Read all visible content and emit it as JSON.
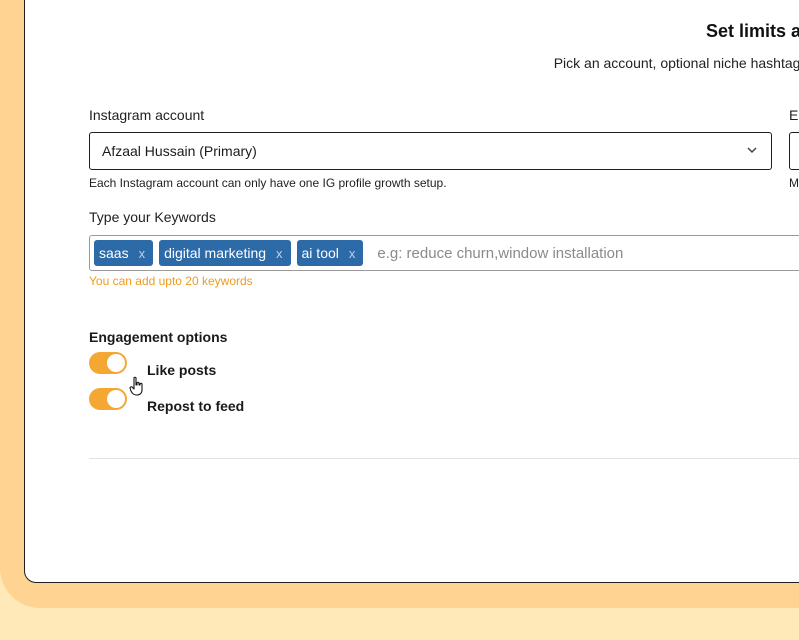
{
  "header": {
    "title": "Set limits and",
    "subtitle": "Pick an account, optional niche hashtags, a"
  },
  "account": {
    "label": "Instagram account",
    "selected": "Afzaal Hussain (Primary)",
    "help": "Each Instagram account can only have one IG profile growth setup."
  },
  "right_column": {
    "label_fragment": "En",
    "help_fragment": "M"
  },
  "keywords": {
    "label": "Type your Keywords",
    "tags": [
      "saas",
      "digital marketing",
      "ai tool"
    ],
    "remove_glyph": "x",
    "placeholder": "e.g: reduce churn,window installation",
    "help": "You can add upto 20 keywords"
  },
  "engagement": {
    "title": "Engagement options",
    "options": [
      {
        "label": "Like posts",
        "enabled": true
      },
      {
        "label": "Repost to feed",
        "enabled": true
      }
    ]
  },
  "colors": {
    "accent": "#f5a733",
    "tag_bg": "#2c6aa8",
    "help_orange": "#f09a1e",
    "background": "#ffe9b8"
  },
  "icons": {
    "select_chevron": "chevron-down-icon",
    "cursor": "pointer-hand-icon"
  }
}
